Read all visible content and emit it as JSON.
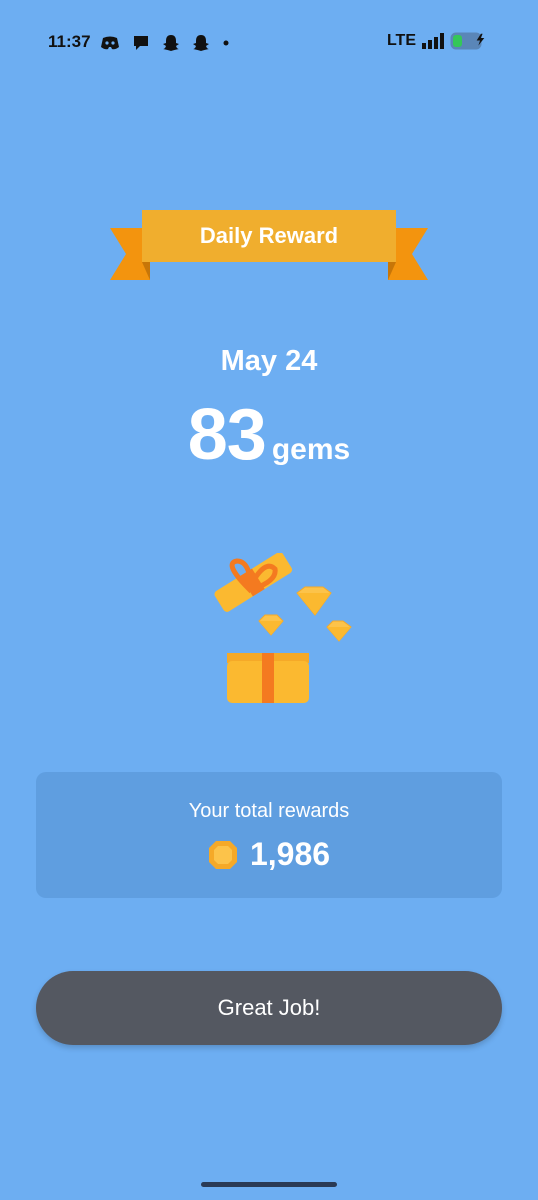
{
  "status_bar": {
    "time": "11:37",
    "network": "LTE",
    "notification_icons": [
      "discord-icon",
      "chat-bubble-icon",
      "snapchat-icon",
      "snapchat-icon",
      "dot-icon"
    ]
  },
  "reward": {
    "banner_title": "Daily Reward",
    "date": "May 24",
    "amount": "83",
    "unit": "gems"
  },
  "totals": {
    "label": "Your total rewards",
    "value": "1,986",
    "icon": "gem-icon"
  },
  "actions": {
    "confirm_label": "Great Job!"
  },
  "colors": {
    "background": "#6daef2",
    "card": "#5f9ee0",
    "button": "#545861",
    "ribbon": "#f0ae2e",
    "gift": "#fbb930"
  }
}
